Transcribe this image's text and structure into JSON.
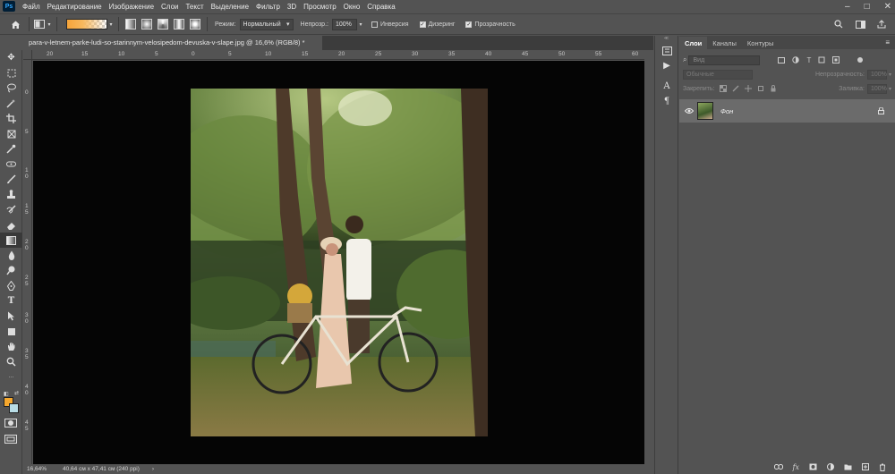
{
  "app": {
    "logo": "Ps"
  },
  "menu": [
    "Файл",
    "Редактирование",
    "Изображение",
    "Слои",
    "Текст",
    "Выделение",
    "Фильтр",
    "3D",
    "Просмотр",
    "Окно",
    "Справка"
  ],
  "window_controls": [
    "–",
    "□",
    "✕"
  ],
  "options": {
    "mode_label": "Режим:",
    "mode_value": "Нормальный",
    "opacity_label": "Непрозр.:",
    "opacity_value": "100%",
    "invert_label": "Инверсия",
    "dither_label": "Дизеринг",
    "transparency_label": "Прозрачность",
    "invert_checked": false,
    "dither_checked": true,
    "transparency_checked": true
  },
  "document": {
    "tab_title": "para-v-letnem-parke-ludi-so-starinnym-velosipedom-devuska-v-slape.jpg @ 16,6% (RGB/8) *",
    "ruler_top": [
      "20",
      "15",
      "10",
      "5",
      "0",
      "5",
      "10",
      "15",
      "20",
      "25",
      "30",
      "35",
      "40",
      "45",
      "50",
      "55",
      "60"
    ],
    "ruler_left": [
      "0",
      "5",
      "1 0",
      "1 5",
      "2 0",
      "2 5",
      "3 0",
      "3 5",
      "4 0",
      "4 5"
    ]
  },
  "status": {
    "zoom": "16,64%",
    "info": "40,64 см x 47,41 см (240 ppi)",
    "arrow": "›"
  },
  "layers_panel": {
    "tabs": [
      "Слои",
      "Каналы",
      "Контуры"
    ],
    "search_placeholder": "Вид",
    "blend_mode": "Обычные",
    "opacity_label": "Непрозрачность:",
    "opacity_value": "100%",
    "lock_label": "Закрепить:",
    "fill_label": "Заливка:",
    "fill_value": "100%",
    "layers": [
      {
        "name": "Фон",
        "locked": true,
        "visible": true
      }
    ]
  },
  "colors": {
    "foreground": "#f5a82e",
    "background": "#b9dde6",
    "canvas": "#050505",
    "ui": "#535353"
  }
}
